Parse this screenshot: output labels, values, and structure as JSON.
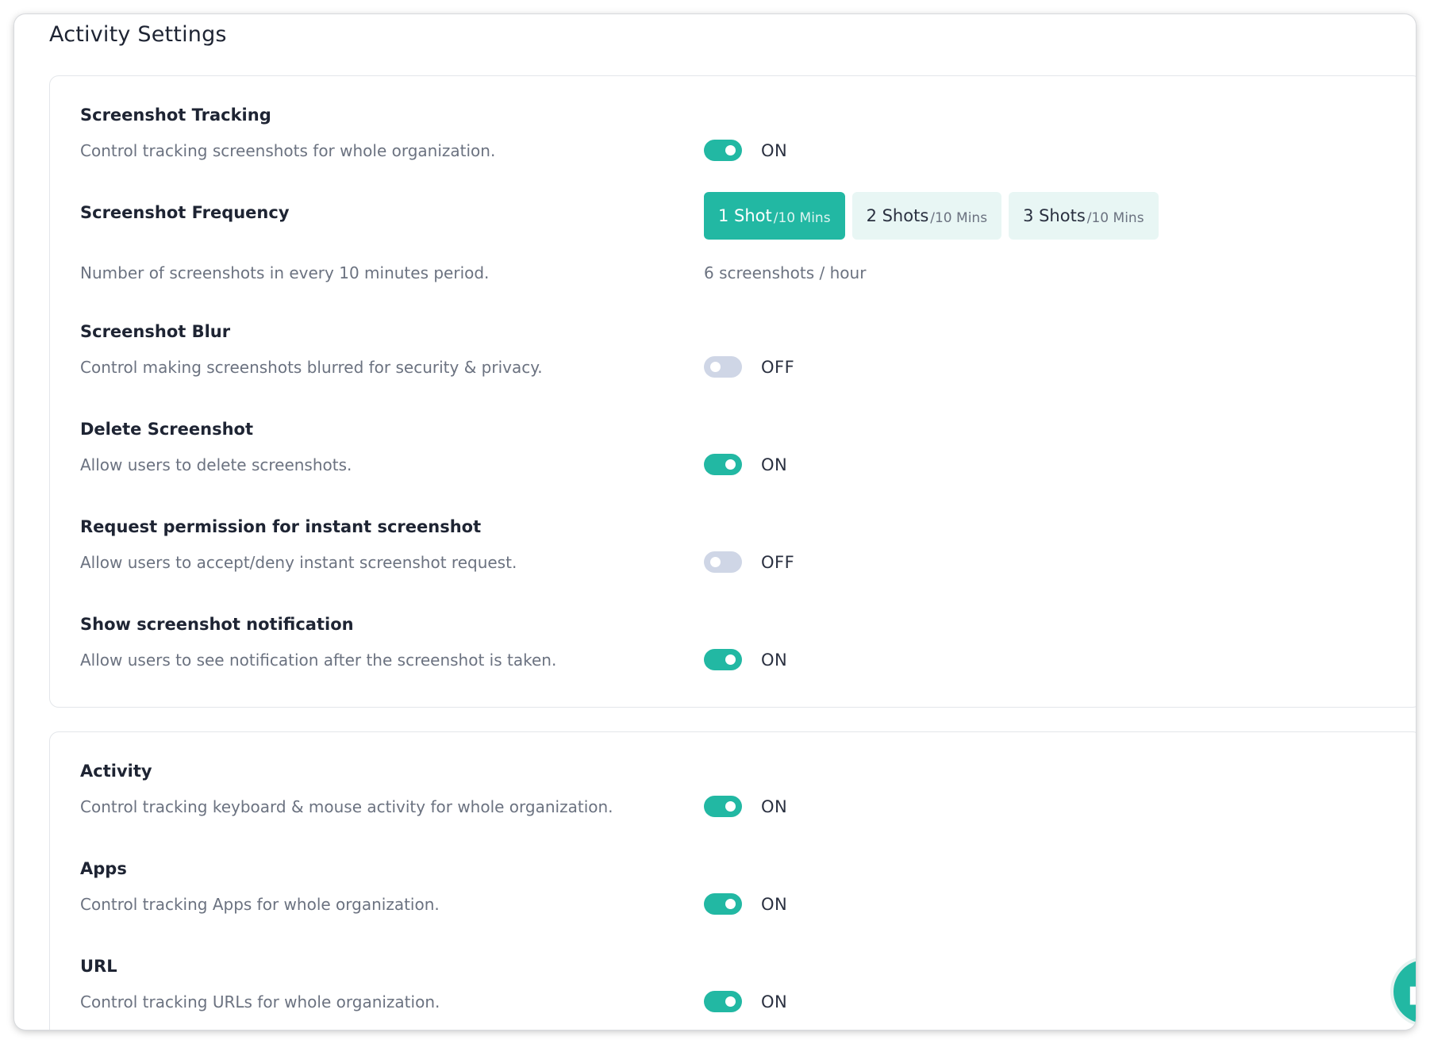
{
  "page": {
    "title": "Activity Settings"
  },
  "colors": {
    "accent": "#22b8a3",
    "toggle_off": "#cfd6e6",
    "accent_light": "#e8f6f4"
  },
  "screenshot_settings": {
    "tracking": {
      "title": "Screenshot Tracking",
      "description": "Control tracking screenshots for whole organization.",
      "state": "ON"
    },
    "frequency": {
      "title": "Screenshot Frequency",
      "description": "Number of screenshots in every 10 minutes period.",
      "options": [
        {
          "main": "1 Shot",
          "sub": "/10 Mins",
          "selected": true
        },
        {
          "main": "2 Shots",
          "sub": "/10 Mins",
          "selected": false
        },
        {
          "main": "3 Shots",
          "sub": "/10 Mins",
          "selected": false
        }
      ],
      "summary": "6 screenshots / hour"
    },
    "blur": {
      "title": "Screenshot Blur",
      "description": "Control making screenshots blurred for security & privacy.",
      "state": "OFF"
    },
    "delete": {
      "title": "Delete Screenshot",
      "description": "Allow users to delete screenshots.",
      "state": "ON"
    },
    "permission": {
      "title": "Request permission for instant screenshot",
      "description": "Allow users to accept/deny instant screenshot request.",
      "state": "OFF"
    },
    "notification": {
      "title": "Show screenshot notification",
      "description": "Allow users to see notification after the screenshot is taken.",
      "state": "ON"
    }
  },
  "activity_settings": {
    "activity": {
      "title": "Activity",
      "description": "Control tracking keyboard & mouse activity for whole organization.",
      "state": "ON"
    },
    "apps": {
      "title": "Apps",
      "description": "Control tracking Apps for whole organization.",
      "state": "ON"
    },
    "url": {
      "title": "URL",
      "description": "Control tracking URLs for whole organization.",
      "state": "ON"
    }
  },
  "chat": {
    "icon": "chat-icon"
  }
}
